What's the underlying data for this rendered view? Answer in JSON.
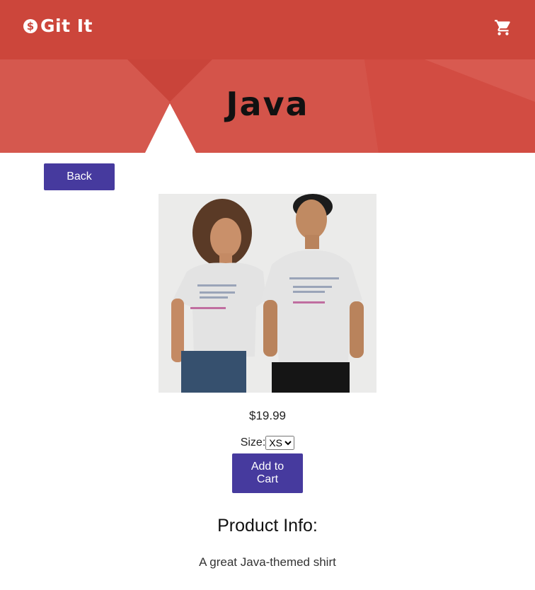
{
  "header": {
    "brand_icon": "$",
    "brand_name": "Git It",
    "cart_icon": "shopping-cart-icon",
    "background_color": "#cc463b"
  },
  "hero": {
    "title": "Java"
  },
  "product": {
    "back_label": "Back",
    "image_alt": "Java",
    "price": "$19.99",
    "size_label": "Size:",
    "size_selected": "XS",
    "add_to_cart_label": "Add to Cart",
    "info_heading": "Product Info:",
    "description": "A great Java-themed shirt"
  },
  "colors": {
    "accent": "#463a9e",
    "brand": "#cc463b"
  }
}
